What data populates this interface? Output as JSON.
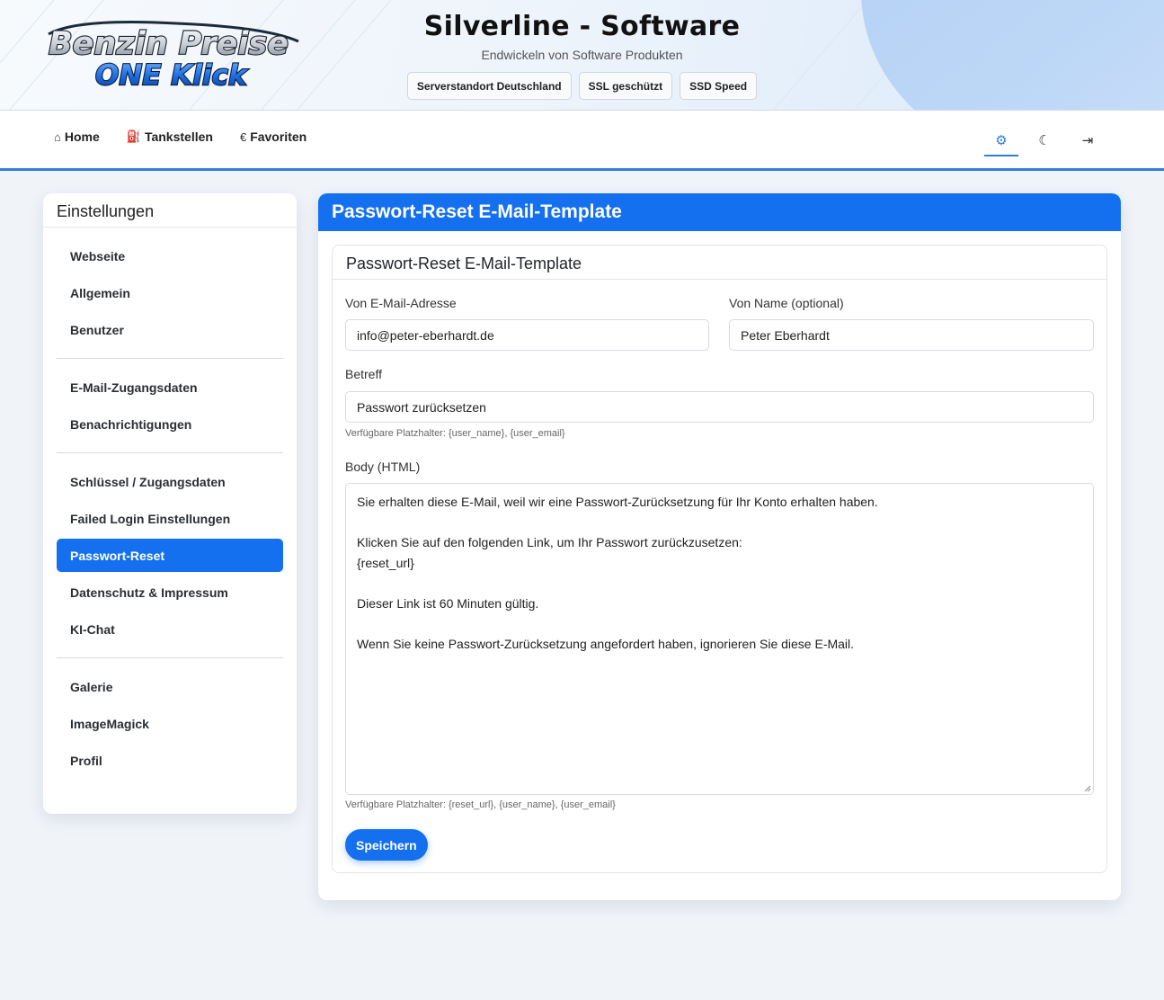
{
  "header": {
    "logo_line1": "Benzin Preise",
    "logo_line2": "ONE Klick",
    "title": "Silverline - Software",
    "subtitle": "Endwickeln von Software Produkten",
    "badges": [
      "Serverstandort Deutschland",
      "SSL geschützt",
      "SSD Speed"
    ]
  },
  "nav": {
    "links": [
      {
        "label": "Home",
        "icon": "home-icon",
        "glyph": "⌂"
      },
      {
        "label": "Tankstellen",
        "icon": "fuel-pump-icon",
        "glyph": "⛽"
      },
      {
        "label": "Favoriten",
        "icon": "euro-icon",
        "glyph": "€"
      }
    ],
    "icons": [
      {
        "name": "settings-icon",
        "glyph": "⚙",
        "active": true
      },
      {
        "name": "moon-icon",
        "glyph": "☾",
        "active": false
      },
      {
        "name": "logout-icon",
        "glyph": "⇥",
        "active": false
      }
    ],
    "accent_color": "#2f7de1"
  },
  "sidebar": {
    "title": "Einstellungen",
    "groups": [
      [
        "Webseite",
        "Allgemein",
        "Benutzer"
      ],
      [
        "E-Mail-Zugangsdaten",
        "Benachrichtigungen"
      ],
      [
        "Schlüssel / Zugangsdaten",
        "Failed Login Einstellungen",
        "Passwort-Reset",
        "Datenschutz & Impressum",
        "KI-Chat"
      ],
      [
        "Galerie",
        "ImageMagick",
        "Profil"
      ]
    ],
    "active_item": "Passwort-Reset",
    "active_color": "#1570f0"
  },
  "main": {
    "header_title": "Passwort-Reset E-Mail-Template",
    "card_title": "Passwort-Reset E-Mail-Template",
    "form": {
      "from_email_label": "Von E-Mail-Adresse",
      "from_email_value": "info@peter-eberhardt.de",
      "from_name_label": "Von Name (optional)",
      "from_name_value": "Peter Eberhardt",
      "subject_label": "Betreff",
      "subject_value": "Passwort zurücksetzen",
      "subject_help": "Verfügbare Platzhalter: {user_name}, {user_email}",
      "body_label": "Body (HTML)",
      "body_lines": [
        "Sie erhalten diese E-Mail, weil wir eine Passwort-Zurücksetzung für Ihr Konto erhalten haben.",
        "",
        "Klicken Sie auf den folgenden Link, um Ihr Passwort zurückzusetzen:",
        "{reset_url}",
        "",
        "Dieser Link ist 60 Minuten gültig.",
        "",
        "Wenn Sie keine Passwort-Zurücksetzung angefordert haben, ignorieren Sie diese E-Mail."
      ],
      "body_help": "Verfügbare Platzhalter: {reset_url}, {user_name}, {user_email}",
      "save_label": "Speichern"
    }
  }
}
